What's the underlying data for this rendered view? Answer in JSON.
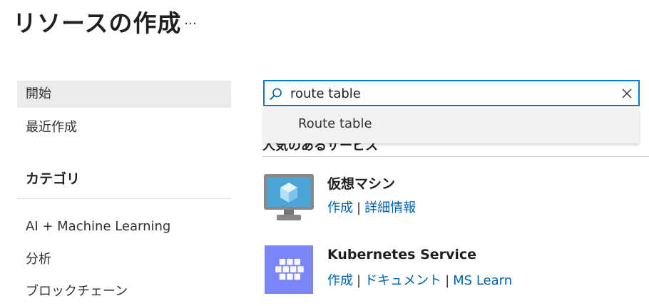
{
  "header": {
    "title": "リソースの作成",
    "more_label": "…"
  },
  "sidebar": {
    "items": [
      {
        "label": "開始",
        "selected": true
      },
      {
        "label": "最近作成",
        "selected": false
      }
    ],
    "categories_heading": "カテゴリ",
    "categories": [
      {
        "label": "AI + Machine Learning"
      },
      {
        "label": "分析"
      },
      {
        "label": "ブロックチェーン"
      }
    ]
  },
  "search": {
    "value": "route table",
    "placeholder": "",
    "suggestions": [
      "Route table"
    ]
  },
  "main": {
    "section_heading": "人気のあるサービス",
    "services": [
      {
        "name": "仮想マシン",
        "icon": "virtual-machine-icon",
        "links": [
          "作成",
          "詳細情報"
        ]
      },
      {
        "name": "Kubernetes Service",
        "icon": "kubernetes-icon",
        "links": [
          "作成",
          "ドキュメント",
          "MS Learn"
        ]
      }
    ]
  },
  "colors": {
    "accent": "#0078d4",
    "link": "#0062ad",
    "selected_bg": "#edebe9",
    "kubernetes_tile": "#7a85f7",
    "vm_screen": "#4aa4d8"
  }
}
